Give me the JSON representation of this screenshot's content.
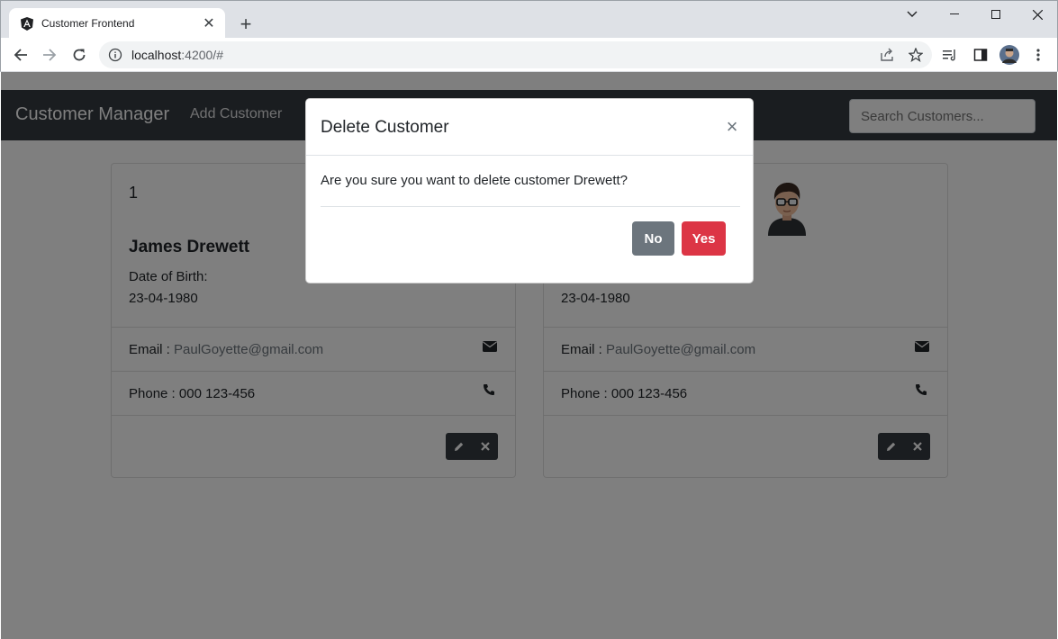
{
  "browser": {
    "tab_title": "Customer Frontend",
    "url_host": "localhost",
    "url_path": ":4200/#"
  },
  "navbar": {
    "brand": "Customer Manager",
    "add_link": "Add Customer",
    "search_placeholder": "Search Customers..."
  },
  "cards": [
    {
      "id": "1",
      "name": "James Drewett",
      "dob_label": "Date of Birth:",
      "dob": "23-04-1980",
      "email_label": "Email : ",
      "email": "PaulGoyette@gmail.com",
      "phone_label": "Phone : ",
      "phone": "000 123-456"
    },
    {
      "dob": "23-04-1980",
      "email_label": "Email : ",
      "email": "PaulGoyette@gmail.com",
      "phone_label": "Phone : ",
      "phone": "000 123-456"
    }
  ],
  "modal": {
    "title": "Delete Customer",
    "close": "×",
    "body": "Are you sure you want to delete customer Drewett?",
    "no_label": "No",
    "yes_label": "Yes"
  },
  "colors": {
    "navbar": "#343a40",
    "danger": "#dc3545",
    "secondary": "#6c757d"
  }
}
